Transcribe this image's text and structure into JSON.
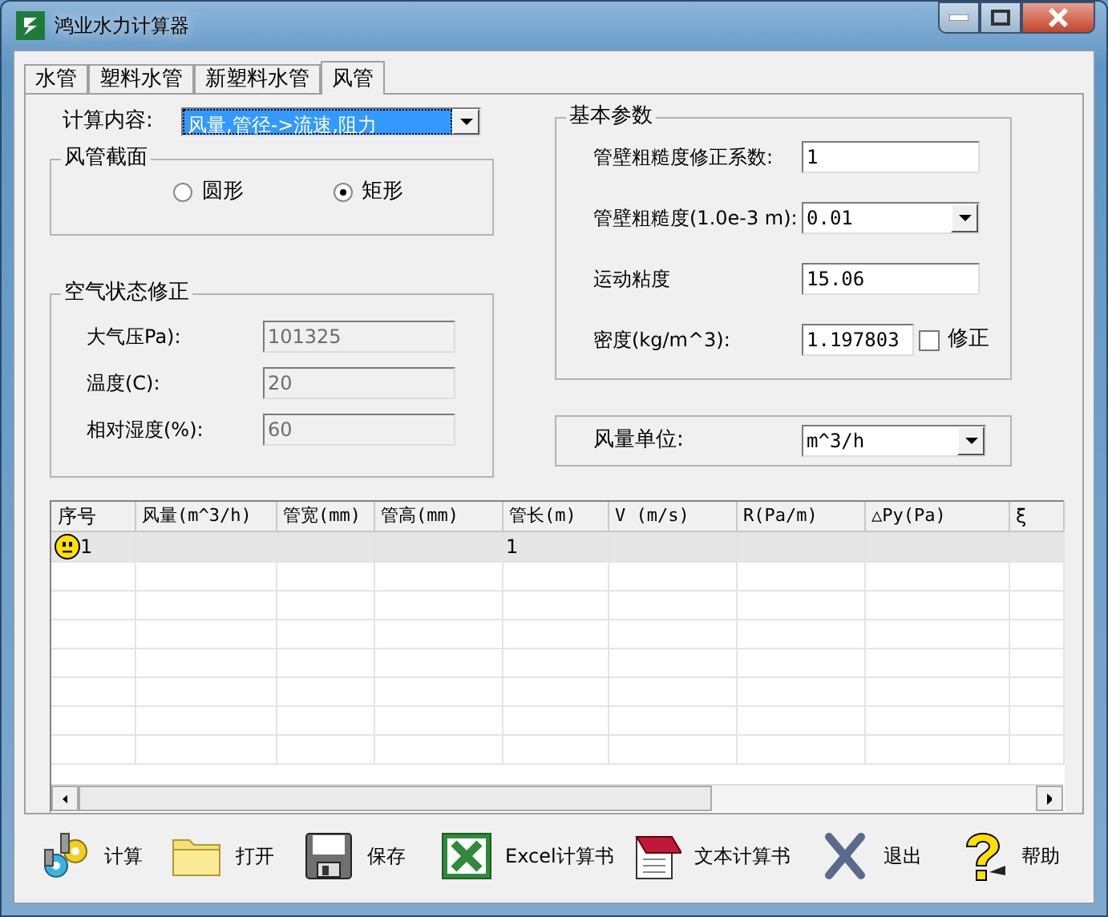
{
  "window": {
    "title": "鸿业水力计算器"
  },
  "tabs": [
    {
      "label": "水管",
      "selected": false
    },
    {
      "label": "塑料水管",
      "selected": false
    },
    {
      "label": "新塑料水管",
      "selected": false
    },
    {
      "label": "风管",
      "selected": true
    }
  ],
  "calc_content": {
    "label": "计算内容:",
    "value": "风量,管径->流速,阻力"
  },
  "duct_section": {
    "title": "风管截面",
    "options": [
      {
        "label": "圆形",
        "selected": false
      },
      {
        "label": "矩形",
        "selected": true
      }
    ]
  },
  "air_correction": {
    "title": "空气状态修正",
    "fields": [
      {
        "label": "大气压Pa):",
        "value": "101325",
        "disabled": true
      },
      {
        "label": "温度(C):",
        "value": "20",
        "disabled": true
      },
      {
        "label": "相对湿度(%):",
        "value": "60",
        "disabled": true
      }
    ]
  },
  "basic_params": {
    "title": "基本参数",
    "fields": [
      {
        "kind": "text",
        "label": "管壁粗糙度修正系数:",
        "value": "1"
      },
      {
        "kind": "select",
        "label": "管壁粗糙度(1.0e-3 m):",
        "value": "0.01"
      },
      {
        "kind": "text",
        "label": "运动粘度",
        "value": "15.06"
      },
      {
        "kind": "check",
        "label": "密度(kg/m^3):",
        "value": "1.197803",
        "check_label": "修正",
        "checked": false
      }
    ]
  },
  "air_unit": {
    "label": "风量单位:",
    "value": "m^3/h"
  },
  "table": {
    "columns": [
      "序号",
      "风量(m^3/h)",
      "管宽(mm)",
      "管高(mm)",
      "管长(m)",
      "V (m/s)",
      "R(Pa/m)",
      "△Py(Pa)",
      "ξ"
    ],
    "rows": [
      {
        "selected": true,
        "cells": [
          "1",
          null,
          null,
          null,
          "1",
          null,
          null,
          null,
          null
        ]
      }
    ]
  },
  "toolbar": [
    {
      "label": "计算"
    },
    {
      "label": "打开"
    },
    {
      "label": "保存"
    },
    {
      "label": "Excel计算书"
    },
    {
      "label": "文本计算书"
    },
    {
      "label": "退出"
    },
    {
      "label": "帮助"
    }
  ]
}
